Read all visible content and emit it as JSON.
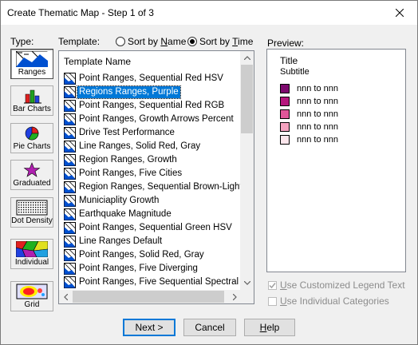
{
  "window": {
    "title": "Create Thematic Map - Step 1 of 3"
  },
  "labels": {
    "type": "Type:",
    "template": "Template:",
    "preview": "Preview:"
  },
  "sort": {
    "by_name_prefix": "Sort by ",
    "by_name_key": "N",
    "by_name_suffix": "ame",
    "by_name_selected": false,
    "by_time_prefix": "Sort by ",
    "by_time_key": "T",
    "by_time_suffix": "ime",
    "by_time_selected": true
  },
  "types": [
    {
      "label": "Ranges",
      "icon": "ranges-icon",
      "selected": true
    },
    {
      "label": "Bar Charts",
      "icon": "bar-chart-icon",
      "selected": false
    },
    {
      "label": "Pie Charts",
      "icon": "pie-chart-icon",
      "selected": false
    },
    {
      "label": "Graduated",
      "icon": "graduated-star-icon",
      "selected": false
    },
    {
      "label": "Dot Density",
      "icon": "dot-density-icon",
      "selected": false
    },
    {
      "label": "Individual",
      "icon": "individual-icon",
      "selected": false
    },
    {
      "label": "Grid",
      "icon": "grid-icon",
      "selected": false
    }
  ],
  "template_list": {
    "header": "Template Name",
    "selected_index": 1,
    "items": [
      "Point Ranges, Sequential Red HSV",
      "Regions Ranges, Purple",
      "Point Ranges, Sequential Red RGB",
      "Point Ranges, Growth Arrows Percent",
      "Drive Test Performance",
      "Line Ranges, Solid Red, Gray",
      "Region Ranges, Growth",
      "Point Ranges, Five Cities",
      "Region Ranges, Sequential Brown-Light Yel",
      "Municiaplity Growth",
      "Earthquake Magnitude",
      "Point Ranges, Sequential Green HSV",
      "Line Ranges Default",
      "Point Ranges, Solid Red, Gray",
      "Point Ranges, Five Diverging",
      "Point Ranges, Five Sequential Spectral"
    ]
  },
  "preview": {
    "title": "Title",
    "subtitle": "Subtitle",
    "legend": [
      {
        "text": "nnn to nnn",
        "color": "#7d0a6e"
      },
      {
        "text": "nnn to nnn",
        "color": "#b5167d"
      },
      {
        "text": "nnn to nnn",
        "color": "#e05599"
      },
      {
        "text": "nnn to nnn",
        "color": "#f5a3c0"
      },
      {
        "text": "nnn to nnn",
        "color": "#fde6ec"
      }
    ]
  },
  "options": {
    "customized_legend": {
      "label_key": "U",
      "label_rest": "se Customized Legend Text",
      "checked": true,
      "enabled": false
    },
    "individual_categories": {
      "label_key": "U",
      "label_rest": "se Individual Categories",
      "checked": false,
      "enabled": false
    }
  },
  "buttons": {
    "next": "Next >",
    "cancel": "Cancel",
    "help_key": "H",
    "help_rest": "elp"
  }
}
